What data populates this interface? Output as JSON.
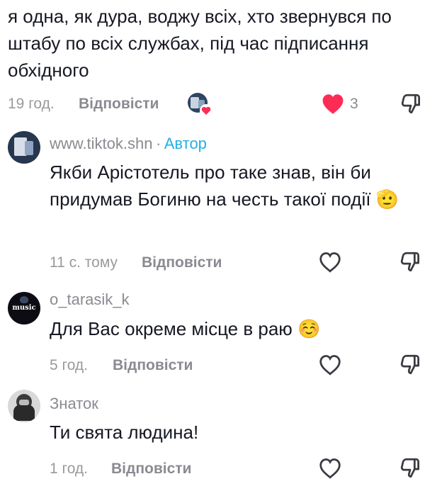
{
  "comment_top": {
    "text": "я одна, як дура, воджу всіх, хто звернувся по штабу по всіх службах, під час підписання обхідного",
    "time": "19 год.",
    "reply_label": "Відповісти",
    "like_count": "3",
    "liked": true
  },
  "reply_1": {
    "username": "www.tiktok.shn",
    "separator": "·",
    "author_label": "Автор",
    "text": "Якби Арістотель про таке знав, він би придумав Богиню на честь такої події",
    "emoji": "🫡",
    "time": "11 с. тому",
    "reply_label": "Відповісти"
  },
  "reply_2": {
    "username": "o_tarasik_k",
    "avatar_text": "music",
    "text": "Для Вас окреме місце в раю",
    "emoji": "☺️",
    "time": "5 год.",
    "reply_label": "Відповісти"
  },
  "reply_3": {
    "username": "Знаток",
    "text": "Ти свята людина!",
    "time": "1 год.",
    "reply_label": "Відповісти"
  },
  "colors": {
    "like_red": "#fe2c55",
    "author_blue": "#25aee5",
    "muted": "#8a8b91"
  }
}
